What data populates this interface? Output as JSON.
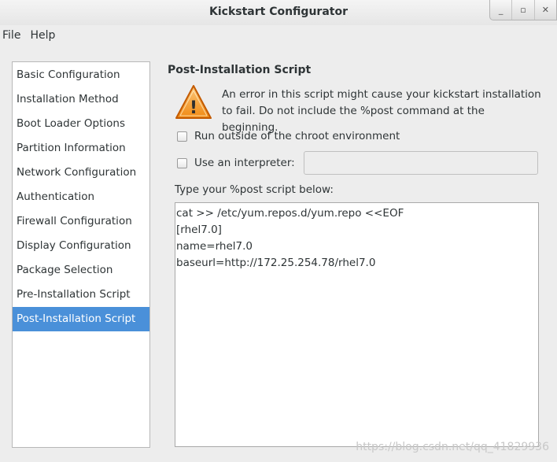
{
  "window": {
    "title": "Kickstart Configurator",
    "buttons": [
      "_",
      "▫",
      "✕"
    ]
  },
  "menubar": [
    "File",
    "Help"
  ],
  "sidebar": {
    "items": [
      {
        "label": "Basic Configuration"
      },
      {
        "label": "Installation Method"
      },
      {
        "label": "Boot Loader Options"
      },
      {
        "label": "Partition Information"
      },
      {
        "label": "Network Configuration"
      },
      {
        "label": "Authentication"
      },
      {
        "label": "Firewall Configuration"
      },
      {
        "label": "Display Configuration"
      },
      {
        "label": "Package Selection"
      },
      {
        "label": "Pre-Installation Script"
      },
      {
        "label": "Post-Installation Script",
        "selected": true
      }
    ]
  },
  "main": {
    "section_title": "Post-Installation Script",
    "warning_icon": "warning-icon",
    "warning_text": "An error in this script might cause your kickstart installation to fail. Do not include the %post command at the beginning.",
    "chroot_checkbox_label": "Run outside of the chroot environment",
    "chroot_checked": false,
    "interpreter_checkbox_label": "Use an interpreter:",
    "interpreter_checked": false,
    "interpreter_value": "",
    "script_label": "Type your %post script below:",
    "script_text": "cat >> /etc/yum.repos.d/yum.repo <<EOF\n[rhel7.0]\nname=rhel7.0\nbaseurl=http://172.25.254.78/rhel7.0"
  },
  "watermark": "https://blog.csdn.net/qq_41829936",
  "colors": {
    "selection": "#4a90d9",
    "background": "#ededed",
    "warning": "#f57900"
  }
}
